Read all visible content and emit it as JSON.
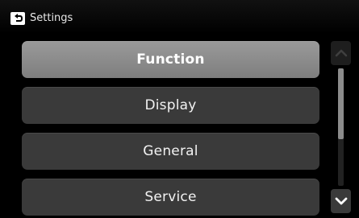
{
  "header": {
    "title": "Settings",
    "back_icon": "back-arrow-icon"
  },
  "menu": {
    "items": [
      {
        "label": "Function",
        "selected": true
      },
      {
        "label": "Display",
        "selected": false
      },
      {
        "label": "General",
        "selected": false
      },
      {
        "label": "Service",
        "selected": false
      }
    ]
  },
  "scrollbar": {
    "up_icon": "chevron-up-icon",
    "down_icon": "chevron-down-icon",
    "thumb_fraction": 0.6,
    "scroll_position": 0
  },
  "colors": {
    "background": "#000000",
    "item_background": "#3a3a3a",
    "selected_item_background": "#8c8c8c",
    "text": "#f2f2f2"
  }
}
